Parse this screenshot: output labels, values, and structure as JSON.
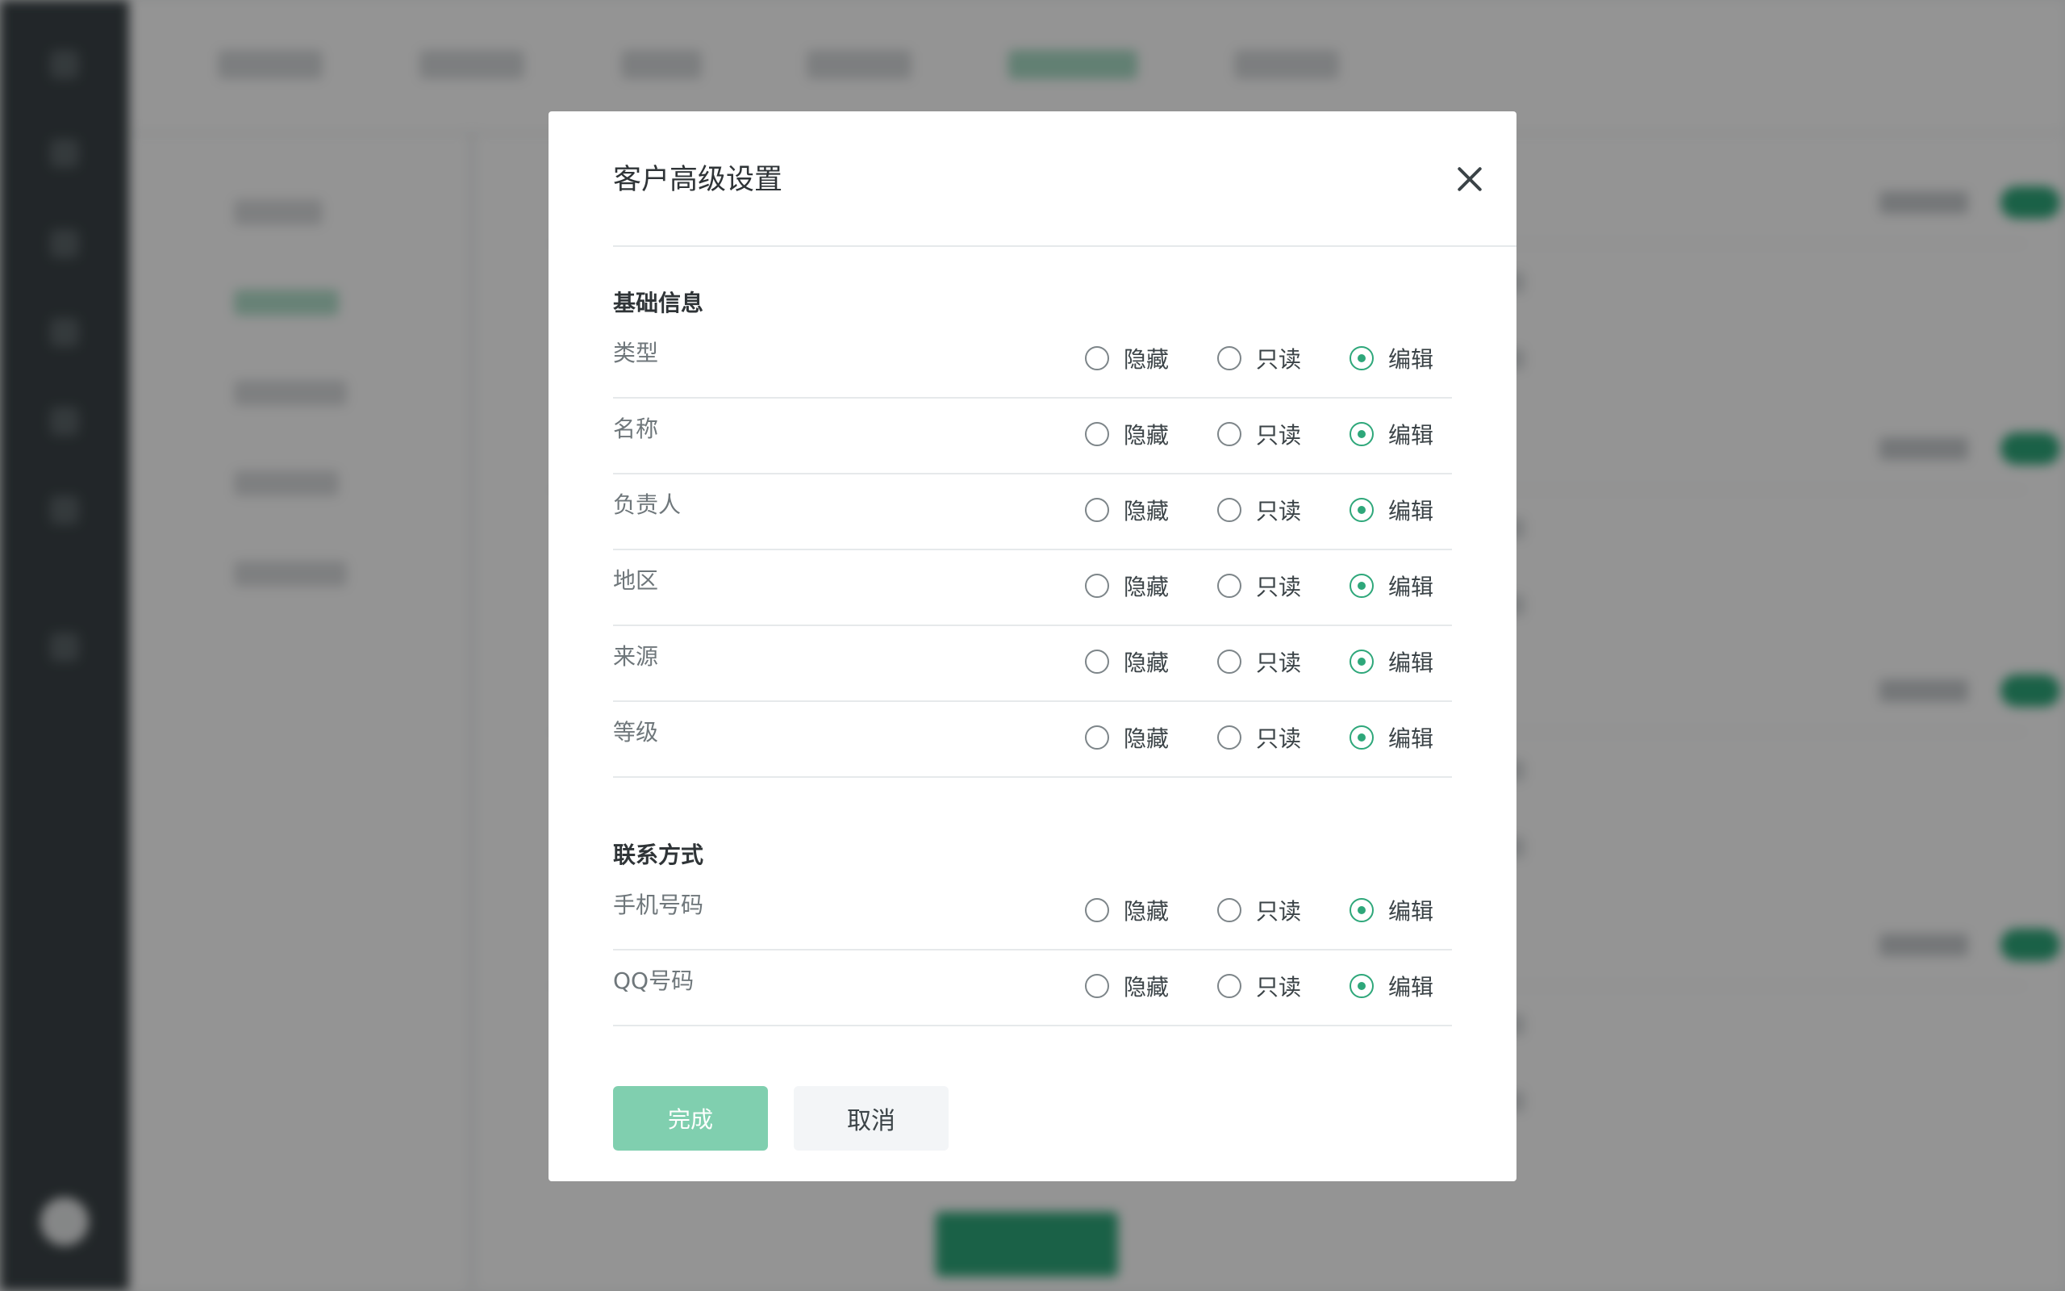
{
  "colors": {
    "accent": "#2ea77a",
    "accent_light": "#80cfaf",
    "rail": "#3b4347",
    "overlay": "rgba(0,0,0,0.42)"
  },
  "modal": {
    "title": "客户高级设置",
    "close_icon": "close-icon",
    "sections": [
      {
        "title": "基础信息",
        "fields": [
          {
            "label": "类型",
            "selected": "编辑"
          },
          {
            "label": "名称",
            "selected": "编辑"
          },
          {
            "label": "负责人",
            "selected": "编辑"
          },
          {
            "label": "地区",
            "selected": "编辑"
          },
          {
            "label": "来源",
            "selected": "编辑"
          },
          {
            "label": "等级",
            "selected": "编辑"
          }
        ]
      },
      {
        "title": "联系方式",
        "fields": [
          {
            "label": "手机号码",
            "selected": "编辑"
          },
          {
            "label": "QQ号码",
            "selected": "编辑"
          }
        ]
      }
    ],
    "options": [
      "隐藏",
      "只读",
      "编辑"
    ],
    "done_label": "完成",
    "cancel_label": "取消"
  }
}
